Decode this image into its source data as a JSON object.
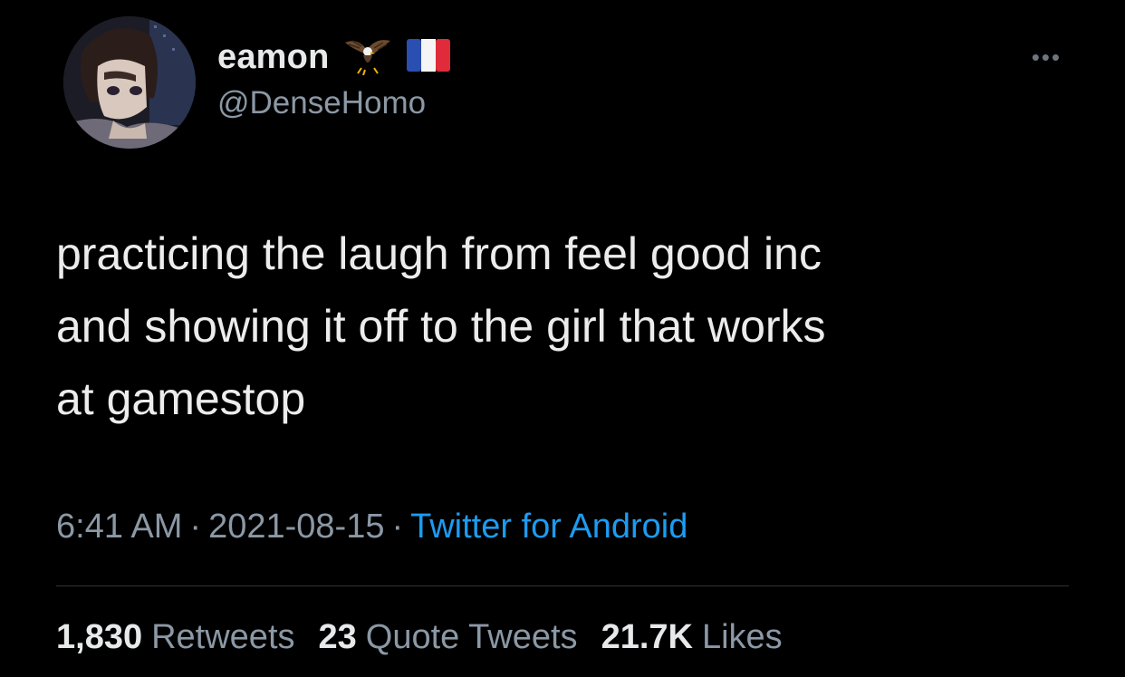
{
  "tweet": {
    "display_name": "eamon",
    "name_emojis": [
      "eagle-emoji",
      "france-flag-emoji"
    ],
    "handle": "@DenseHomo",
    "more_icon": "more-horizontal-icon",
    "text": "practicing the laugh from feel good inc\nand showing it off to the girl that works\nat gamestop",
    "time": "6:41 AM",
    "date": "2021-08-15",
    "separator": "·",
    "source": "Twitter for Android",
    "stats": {
      "retweets_count": "1,830",
      "retweets_label": "Retweets",
      "quotes_count": "23",
      "quotes_label": "Quote Tweets",
      "likes_count": "21.7K",
      "likes_label": "Likes"
    }
  },
  "colors": {
    "background": "#000000",
    "primary_text": "#e7e9ea",
    "secondary_text": "#8b98a5",
    "link": "#1d9bf0",
    "divider": "#2f3336"
  }
}
